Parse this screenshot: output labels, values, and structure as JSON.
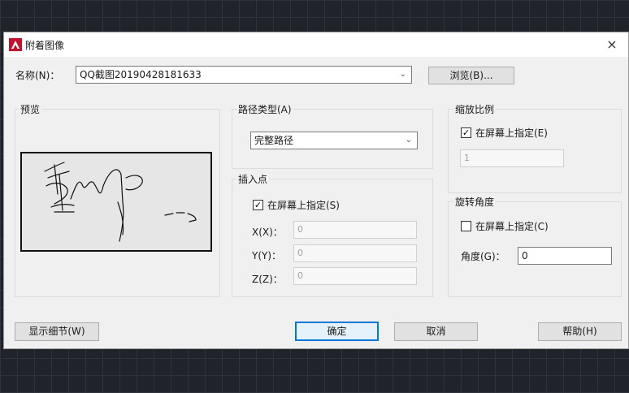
{
  "dialog": {
    "title": "附着图像",
    "close_icon": "×",
    "name_label": "名称(N)：",
    "name_value": "QQ截图20190428181633",
    "browse_button": "浏览(B)...",
    "preview": {
      "label": "预览"
    },
    "path_type": {
      "label": "路径类型(A)",
      "value": "完整路径"
    },
    "insertion_point": {
      "label": "插入点",
      "specify_label": "在屏幕上指定(S)",
      "specify_checked": true,
      "x_label": "X(X)：",
      "x_value": "0",
      "y_label": "Y(Y)：",
      "y_value": "0",
      "z_label": "Z(Z)：",
      "z_value": "0"
    },
    "scale": {
      "label": "缩放比例",
      "specify_label": "在屏幕上指定(E)",
      "specify_checked": true,
      "value": "1"
    },
    "rotation": {
      "label": "旋转角度",
      "specify_label": "在屏幕上指定(C)",
      "specify_checked": false,
      "angle_label": "角度(G)：",
      "angle_value": "0"
    },
    "buttons": {
      "details": "显示细节(W)",
      "ok": "确定",
      "cancel": "取消",
      "help": "帮助(H)"
    }
  }
}
